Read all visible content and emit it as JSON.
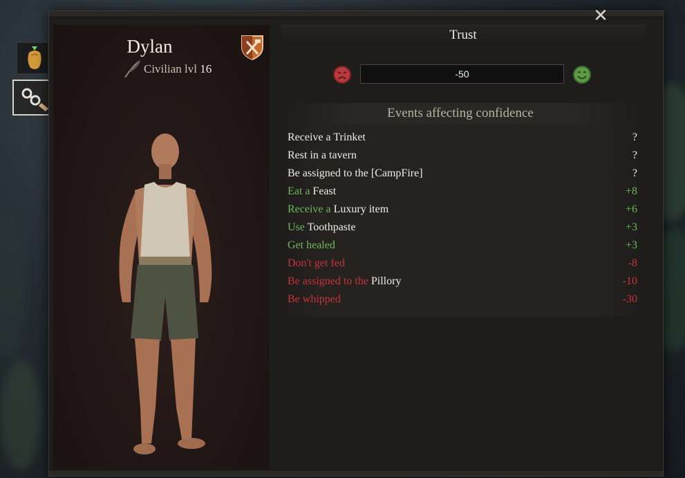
{
  "character": {
    "name": "Dylan",
    "class_label": "Civilian lvl",
    "level": "16"
  },
  "trust": {
    "title": "Trust",
    "value": "-50",
    "close_symbol": "✕"
  },
  "events": {
    "title": "Events affecting confidence",
    "rows": [
      {
        "pre": "Receive a ",
        "obj": "Trinket",
        "value": "?",
        "kind": "neutral"
      },
      {
        "pre": "Rest in a tavern",
        "obj": "",
        "value": "?",
        "kind": "neutral"
      },
      {
        "pre": "Be assigned to the [CampFire]",
        "obj": "",
        "value": "?",
        "kind": "neutral"
      },
      {
        "pre": "Eat a ",
        "obj": "Feast",
        "value": "+8",
        "kind": "positive"
      },
      {
        "pre": "Receive a ",
        "obj": "Luxury item",
        "value": "+6",
        "kind": "positive"
      },
      {
        "pre": "Use ",
        "obj": "Toothpaste",
        "value": "+3",
        "kind": "positive"
      },
      {
        "pre": "Get healed",
        "obj": "",
        "value": "+3",
        "kind": "positive"
      },
      {
        "pre": "Don't get fed",
        "obj": "",
        "value": "-8",
        "kind": "negative"
      },
      {
        "pre": "Be assigned to the ",
        "obj": "Pillory",
        "value": "-10",
        "kind": "negative"
      },
      {
        "pre": "Be whipped",
        "obj": "",
        "value": "-30",
        "kind": "negative"
      }
    ]
  },
  "icons": {
    "side_tab_1": "vegetable-icon",
    "side_tab_2": "shackles-icon",
    "crest": "guild-crest-icon",
    "quill": "quill-icon",
    "bad_face": "angry-face-icon",
    "good_face": "happy-face-icon"
  },
  "colors": {
    "positive": "#6fb85a",
    "negative": "#c9323a",
    "neutral": "#f2ede3"
  }
}
